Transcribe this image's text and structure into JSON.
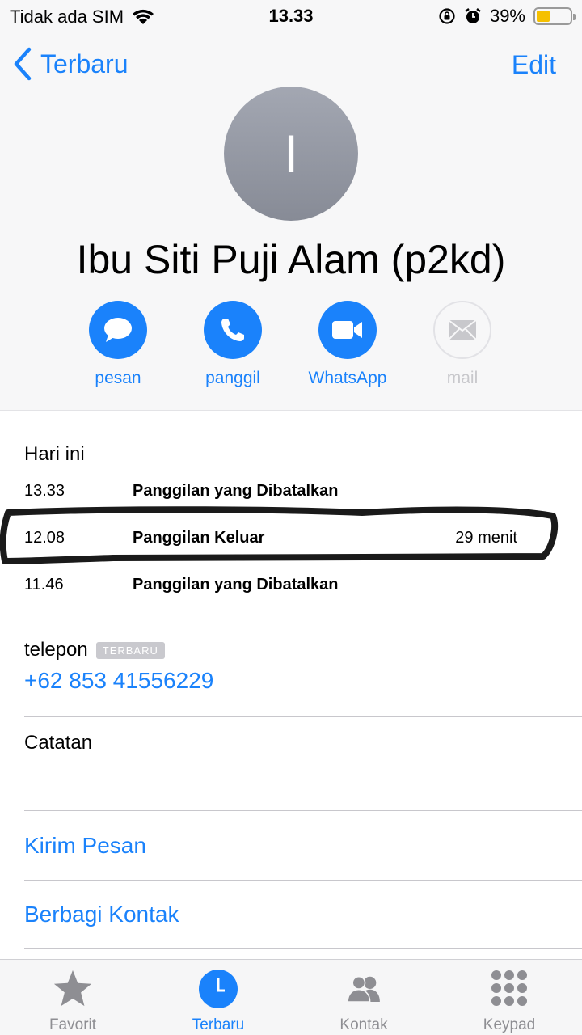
{
  "status_bar": {
    "carrier": "Tidak ada SIM",
    "time": "13.33",
    "battery_percent": "39%",
    "battery_level": 0.39
  },
  "nav": {
    "back_label": "Terbaru",
    "edit_label": "Edit"
  },
  "contact": {
    "initial": "I",
    "name": "Ibu Siti Puji Alam (p2kd)"
  },
  "actions": [
    {
      "label": "pesan",
      "icon": "message-icon",
      "enabled": true
    },
    {
      "label": "panggil",
      "icon": "phone-icon",
      "enabled": true
    },
    {
      "label": "WhatsApp",
      "icon": "video-icon",
      "enabled": true
    },
    {
      "label": "mail",
      "icon": "mail-icon",
      "enabled": false
    }
  ],
  "recents": {
    "title": "Hari ini",
    "calls": [
      {
        "time": "13.33",
        "type": "Panggilan yang Dibatalkan",
        "duration": ""
      },
      {
        "time": "12.08",
        "type": "Panggilan Keluar",
        "duration": "29 menit"
      },
      {
        "time": "11.46",
        "type": "Panggilan yang Dibatalkan",
        "duration": ""
      }
    ]
  },
  "phone": {
    "label": "telepon",
    "badge": "TERBARU",
    "number": "+62 853 41556229"
  },
  "notes": {
    "label": "Catatan"
  },
  "links": {
    "send_message": "Kirim Pesan",
    "share_contact": "Berbagi Kontak"
  },
  "tabs": [
    {
      "label": "Favorit",
      "icon": "star-icon",
      "active": false
    },
    {
      "label": "Terbaru",
      "icon": "clock-icon",
      "active": true
    },
    {
      "label": "Kontak",
      "icon": "contacts-icon",
      "active": false
    },
    {
      "label": "Keypad",
      "icon": "keypad-icon",
      "active": false
    }
  ],
  "colors": {
    "accent": "#1a82fb",
    "battery": "#f5c000"
  }
}
